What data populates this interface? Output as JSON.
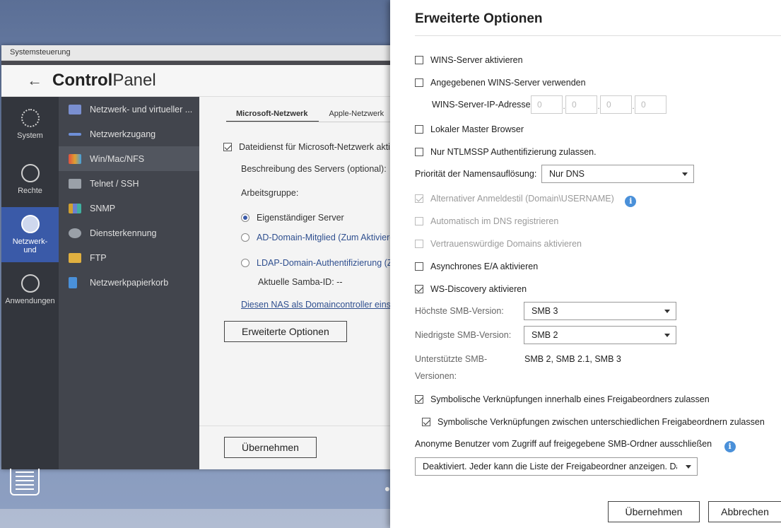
{
  "window": {
    "title": "Systemsteuerung"
  },
  "header": {
    "title_bold": "Control",
    "title_rest": "Panel"
  },
  "left_nav": [
    {
      "label": "System"
    },
    {
      "label": "Rechte"
    },
    {
      "label": "Netzwerk-\nund",
      "active": true
    },
    {
      "label": "Anwendungen"
    }
  ],
  "mid_nav": [
    {
      "label": "Netzwerk- und virtueller ...",
      "color": "#7a8fd0"
    },
    {
      "label": "Netzwerkzugang",
      "color": "#6e8fd8"
    },
    {
      "label": "Win/Mac/NFS",
      "color": "#e0a030",
      "active": true
    },
    {
      "label": "Telnet / SSH",
      "color": "#9aa0a8"
    },
    {
      "label": "SNMP",
      "color": "#d0a030"
    },
    {
      "label": "Diensterkennung",
      "color": "#9aa0a8"
    },
    {
      "label": "FTP",
      "color": "#e0b040"
    },
    {
      "label": "Netzwerkpapierkorb",
      "color": "#4a90d9"
    }
  ],
  "content": {
    "tabs": [
      "Microsoft-Netzwerk",
      "Apple-Netzwerk"
    ],
    "file_service": "Dateidienst für Microsoft-Netzwerk akti",
    "server_desc": "Beschreibung des Servers (optional):",
    "workgroup": "Arbeitsgruppe:",
    "radio_standalone": "Eigenständiger Server",
    "radio_ad": "AD-Domain-Mitglied (Zum Aktiviere",
    "radio_ldap": "LDAP-Domain-Authentifizierung (Zu",
    "samba_id": "Aktuelle Samba-ID: --",
    "dc_link": "Diesen NAS als Domaincontroller einste",
    "advanced_button": "Erweiterte Optionen",
    "apply_button": "Übernehmen"
  },
  "panel": {
    "title": "Erweiterte Optionen",
    "wins_enable": "WINS-Server aktivieren",
    "wins_use": "Angegebenen WINS-Server verwenden",
    "wins_ip_label": "WINS-Server-IP-Adresse",
    "wins_ip": [
      "0",
      "0",
      "0",
      "0"
    ],
    "local_master": "Lokaler Master Browser",
    "ntlmssp": "Nur NTLMSSP Authentifizierung zulassen.",
    "name_res_label": "Priorität der Namensauflösung:",
    "name_res_value": "Nur DNS",
    "alt_login": "Alternativer Anmeldestil (Domain\\USERNAME)",
    "dns_register": "Automatisch im DNS registrieren",
    "trusted_domains": "Vertrauenswürdige Domains aktivieren",
    "async_io": "Asynchrones E/A aktivieren",
    "ws_discovery": "WS-Discovery aktivieren",
    "max_smb_label": "Höchste SMB-Version:",
    "max_smb_value": "SMB 3",
    "min_smb_label": "Niedrigste SMB-Version:",
    "min_smb_value": "SMB 2",
    "supported_label_1": "Unterstützte SMB-",
    "supported_label_2": "Versionen:",
    "supported_value": "SMB 2, SMB 2.1, SMB 3",
    "symlink_within": "Symbolische Verknüpfungen innerhalb eines Freigabeordners zulassen",
    "symlink_between": "Symbolische Verknüpfungen zwischen unterschiedlichen Freigabeordnern zulassen",
    "anon_label": "Anonyme Benutzer vom Zugriff auf freigegebene SMB-Ordner ausschließen",
    "anon_value": "Deaktiviert. Jeder kann die Liste der Freigabeordner anzeigen. Das G",
    "apply_button": "Übernehmen",
    "cancel_button": "Abbrechen"
  }
}
